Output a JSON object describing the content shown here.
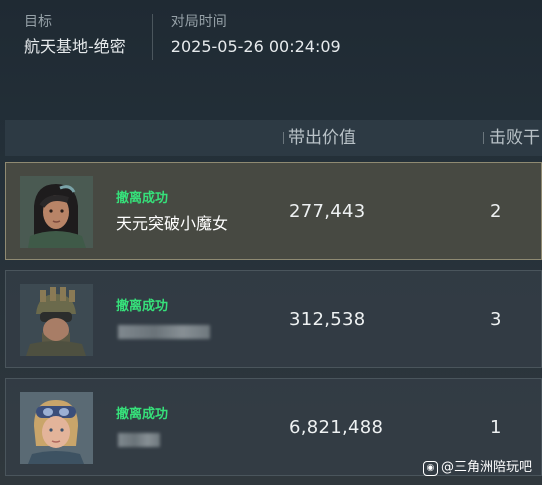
{
  "match": {
    "target_label": "目标",
    "target_value": "航天基地-绝密",
    "time_label": "对局时间",
    "time_value": "2025-05-26 00:24:09"
  },
  "columns": {
    "value": "带出价值",
    "kills": "击败干"
  },
  "players": [
    {
      "status": "撤离成功",
      "name": "天元突破小魔女",
      "value": "277,443",
      "kills": "2",
      "selected": true
    },
    {
      "status": "撤离成功",
      "name": "",
      "value": "312,538",
      "kills": "3",
      "selected": false
    },
    {
      "status": "撤离成功",
      "name": "",
      "value": "6,821,488",
      "kills": "1",
      "selected": false
    }
  ],
  "watermark": {
    "icon": "weibo-logo-icon",
    "text": "@三角洲陪玩吧"
  },
  "colors": {
    "success": "#36e07a",
    "selected_border": "#8f8a72"
  }
}
